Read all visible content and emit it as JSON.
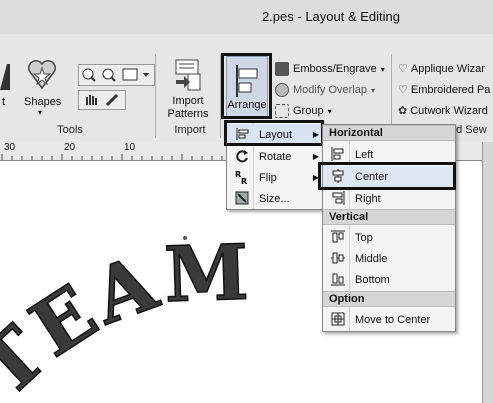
{
  "window": {
    "title": "2.pes - Layout & Editing"
  },
  "ribbon": {
    "tools": {
      "shapes_label": "Shapes",
      "text_label": "t",
      "group_label": "Tools"
    },
    "import": {
      "button_label": "Import Patterns",
      "button_label_line1": "Import",
      "button_label_line2": "Patterns",
      "group_label": "Import"
    },
    "arrange": {
      "button_label": "Arrange"
    },
    "edit": {
      "emboss_label": "Emboss/Engrave",
      "modify_overlap_label": "Modify Overlap",
      "group_label": "Group"
    },
    "wizards": {
      "applique_label": "Applique Wizar",
      "embroidered_label": "Embroidered Pa",
      "cutwork_label": "Cutwork Wizard",
      "group_label": "nd Sew"
    }
  },
  "ruler": {
    "ticks": [
      "30",
      "20",
      "10"
    ]
  },
  "canvas": {
    "text": "TEAM"
  },
  "arrange_menu": {
    "items": [
      {
        "label": "Layout",
        "icon": "layout-icon",
        "submenu": true
      },
      {
        "label": "Rotate",
        "icon": "rotate-icon",
        "submenu": true
      },
      {
        "label": "Flip",
        "icon": "flip-icon",
        "submenu": true
      },
      {
        "label": "Size...",
        "icon": "size-icon",
        "submenu": false
      }
    ]
  },
  "layout_submenu": {
    "horizontal_header": "Horizontal",
    "horizontal": [
      {
        "label": "Left"
      },
      {
        "label": "Center"
      },
      {
        "label": "Right"
      }
    ],
    "vertical_header": "Vertical",
    "vertical": [
      {
        "label": "Top"
      },
      {
        "label": "Middle"
      },
      {
        "label": "Bottom"
      }
    ],
    "option_header": "Option",
    "option": [
      {
        "label": "Move to Center"
      }
    ]
  },
  "colors": {
    "highlight_border": "#111111",
    "menu_bg": "#f4f4f4",
    "ribbon_bg": "#e6e6e6"
  }
}
